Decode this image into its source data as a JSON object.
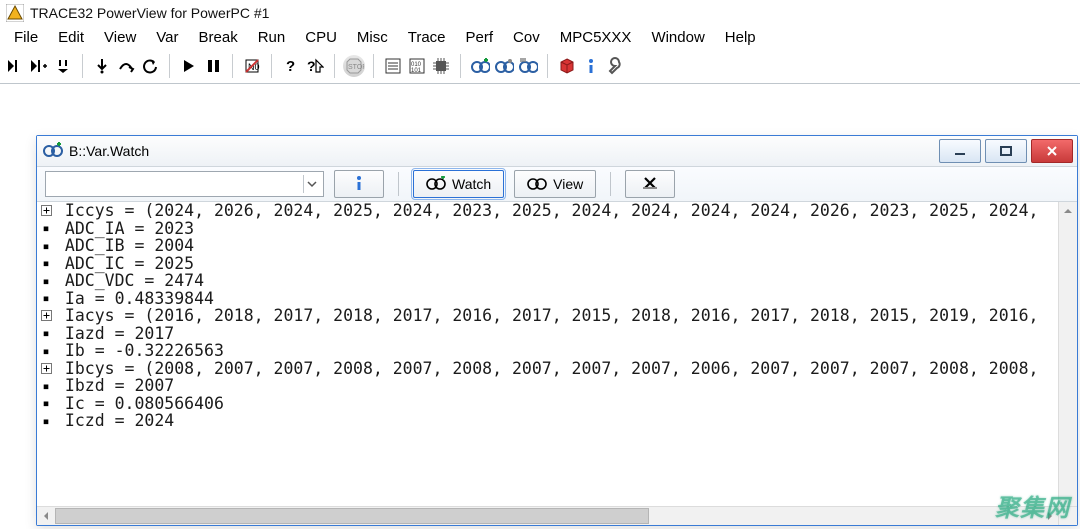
{
  "app": {
    "title": "TRACE32 PowerView for PowerPC #1"
  },
  "menu": {
    "items": [
      "File",
      "Edit",
      "View",
      "Var",
      "Break",
      "Run",
      "CPU",
      "Misc",
      "Trace",
      "Perf",
      "Cov",
      "MPC5XXX",
      "Window",
      "Help"
    ]
  },
  "child_window": {
    "title": "B::Var.Watch",
    "combo_value": "",
    "watch_label": "Watch",
    "view_label": "View"
  },
  "watch_rows": [
    {
      "glyph": "plus",
      "text": "Iccys = (2024, 2026, 2024, 2025, 2024, 2023, 2025, 2024, 2024, 2024, 2024, 2026, 2023, 2025, 2024,"
    },
    {
      "glyph": "dot",
      "text": "ADC_IA = 2023"
    },
    {
      "glyph": "dot",
      "text": "ADC_IB = 2004"
    },
    {
      "glyph": "dot",
      "text": "ADC_IC = 2025"
    },
    {
      "glyph": "dot",
      "text": "ADC_VDC = 2474"
    },
    {
      "glyph": "dot",
      "text": "Ia = 0.48339844"
    },
    {
      "glyph": "plus",
      "text": "Iacys = (2016, 2018, 2017, 2018, 2017, 2016, 2017, 2015, 2018, 2016, 2017, 2018, 2015, 2019, 2016,"
    },
    {
      "glyph": "dot",
      "text": "Iazd = 2017"
    },
    {
      "glyph": "dot",
      "text": "Ib = -0.32226563"
    },
    {
      "glyph": "plus",
      "text": "Ibcys = (2008, 2007, 2007, 2008, 2007, 2008, 2007, 2007, 2007, 2006, 2007, 2007, 2007, 2008, 2008,"
    },
    {
      "glyph": "dot",
      "text": "Ibzd = 2007"
    },
    {
      "glyph": "dot",
      "text": "Ic = 0.080566406"
    },
    {
      "glyph": "dot",
      "text": "Iczd = 2024"
    }
  ],
  "watermark": "聚集网"
}
